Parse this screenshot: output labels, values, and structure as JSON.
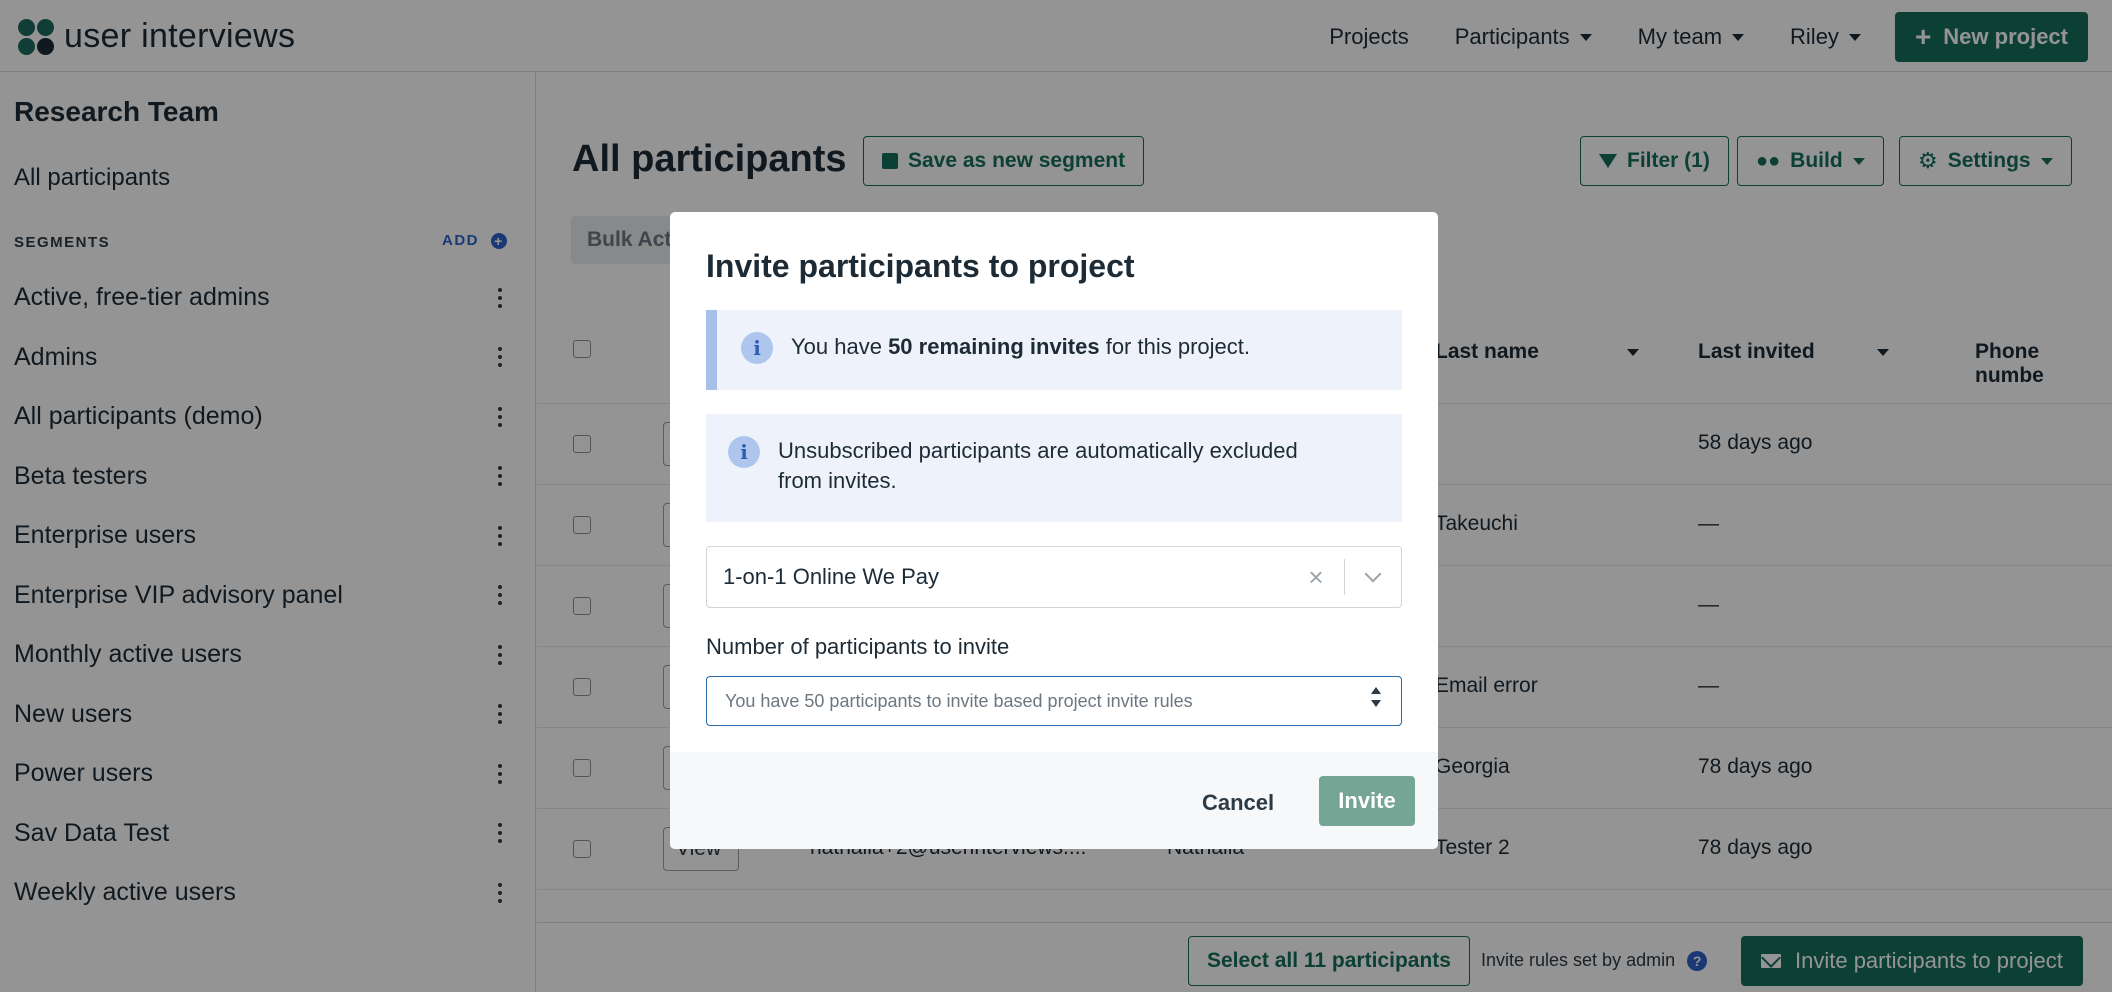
{
  "brand": {
    "name": "user interviews"
  },
  "nav": {
    "projects": "Projects",
    "participants": "Participants",
    "my_team": "My team",
    "user": "Riley",
    "new_project": "New project"
  },
  "sidebar": {
    "title": "Research Team",
    "all_participants": "All participants",
    "segments_heading": "SEGMENTS",
    "add_label": "ADD",
    "items": [
      {
        "label": "Active, free-tier admins"
      },
      {
        "label": "Admins"
      },
      {
        "label": "All participants (demo)"
      },
      {
        "label": "Beta testers"
      },
      {
        "label": "Enterprise users"
      },
      {
        "label": "Enterprise VIP advisory panel"
      },
      {
        "label": "Monthly active users"
      },
      {
        "label": "New users"
      },
      {
        "label": "Power users"
      },
      {
        "label": "Sav Data Test"
      },
      {
        "label": "Weekly active users"
      }
    ]
  },
  "main": {
    "title": "All participants",
    "save_segment": "Save as new segment",
    "filter": "Filter (1)",
    "build": "Build",
    "settings": "Settings",
    "bulk_actions": "Bulk Actions"
  },
  "table": {
    "headers": {
      "last_name": "Last name",
      "last_invited": "Last invited",
      "phone": "Phone numbe"
    },
    "view_label": "View",
    "rows": [
      {
        "last_name": "",
        "last_invited": "58 days ago",
        "email": "",
        "first_name": ""
      },
      {
        "last_name": "Takeuchi",
        "last_invited": "—",
        "email": "",
        "first_name": ""
      },
      {
        "last_name": "",
        "last_invited": "—",
        "email": "",
        "first_name": ""
      },
      {
        "last_name": "Email error",
        "last_invited": "—",
        "email": "",
        "first_name": ""
      },
      {
        "last_name": "Georgia",
        "last_invited": "78 days ago",
        "email": "",
        "first_name": ""
      },
      {
        "last_name": "Tester 2",
        "last_invited": "78 days ago",
        "email": "nathalia+2@userinterviews....",
        "first_name": "Nathalia"
      }
    ]
  },
  "modal": {
    "title": "Invite participants to project",
    "alert1_prefix": "You have ",
    "alert1_bold": "50 remaining invites",
    "alert1_suffix": " for this project.",
    "alert2": "Unsubscribed participants are automatically excluded from invites.",
    "project_select_value": "1-on-1 Online We Pay",
    "count_label": "Number of participants to invite",
    "count_placeholder": "You have 50 participants to invite based project invite rules",
    "cancel": "Cancel",
    "invite": "Invite"
  },
  "bottombar": {
    "select_all": "Select all 11 participants",
    "invite_rules": "Invite rules set by admin",
    "invite_to_project": "Invite participants to project"
  },
  "colors": {
    "brand_green": "#176e5b",
    "invite_disabled": "#74a595",
    "info_bg": "#eef3fb",
    "info_accent": "#a7c0e8",
    "link_blue": "#2e63c9"
  }
}
